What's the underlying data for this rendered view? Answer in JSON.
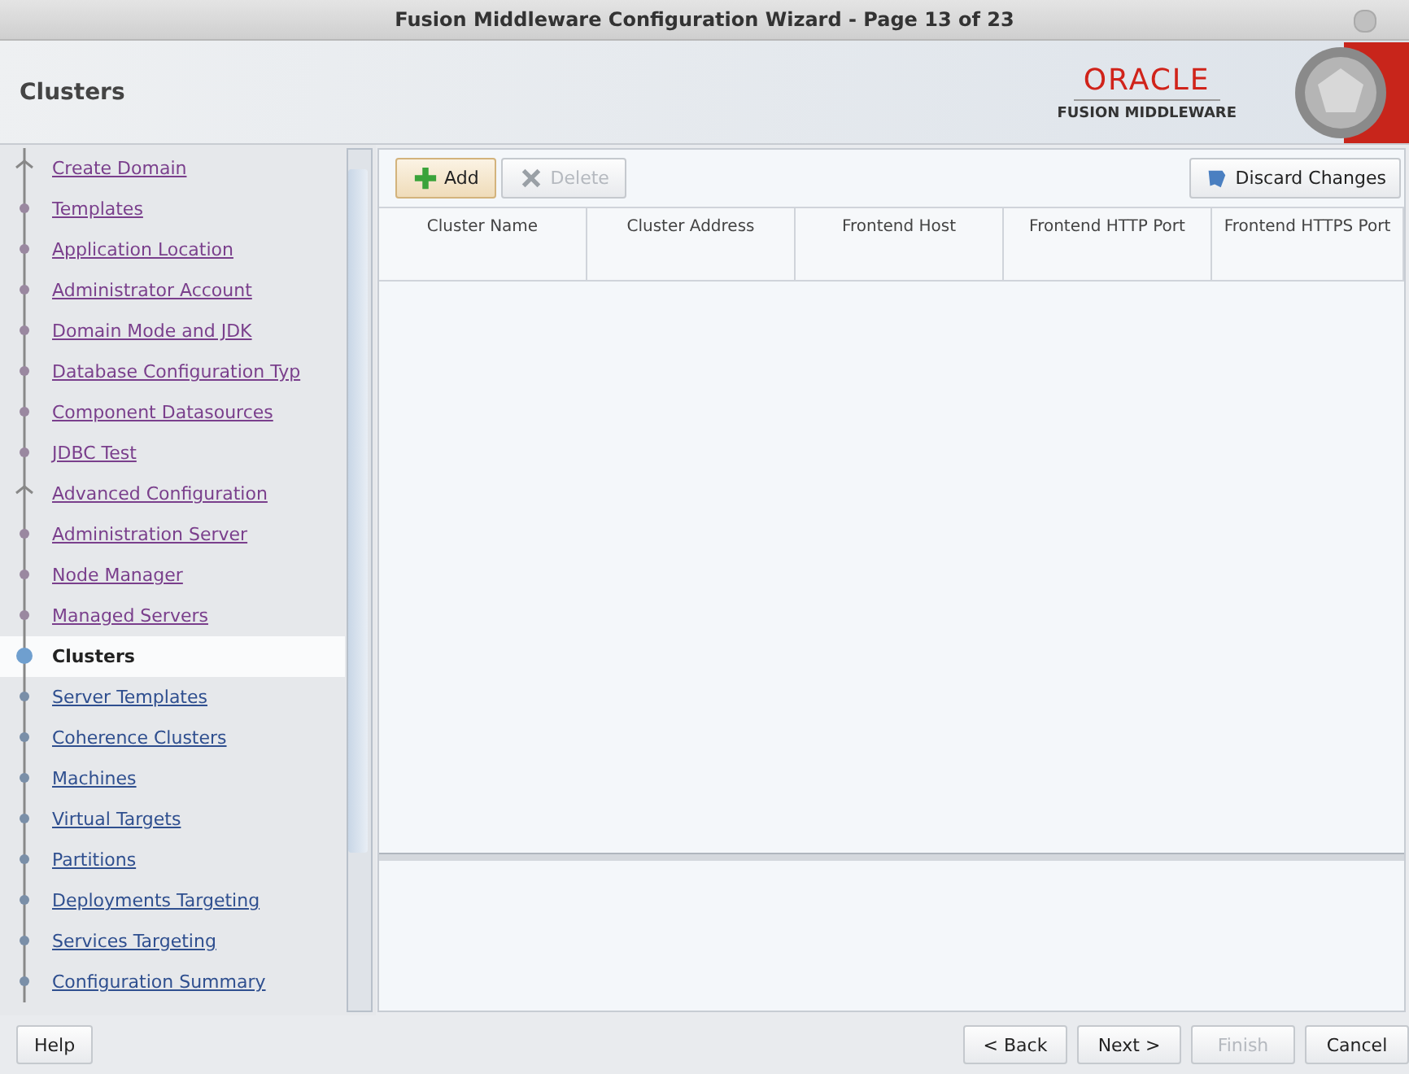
{
  "window": {
    "title": "Fusion Middleware Configuration Wizard - Page 13 of 23"
  },
  "header": {
    "title": "Clusters",
    "logo_top": "ORACLE",
    "logo_bottom": "FUSION MIDDLEWARE"
  },
  "steps": [
    {
      "label": "Create Domain",
      "visited": true,
      "selected": false,
      "kind": "group"
    },
    {
      "label": "Templates",
      "visited": true,
      "selected": false,
      "kind": "step"
    },
    {
      "label": "Application Location",
      "visited": true,
      "selected": false,
      "kind": "step"
    },
    {
      "label": "Administrator Account",
      "visited": true,
      "selected": false,
      "kind": "step"
    },
    {
      "label": "Domain Mode and JDK",
      "visited": true,
      "selected": false,
      "kind": "step"
    },
    {
      "label": "Database Configuration Typ",
      "visited": true,
      "selected": false,
      "kind": "step"
    },
    {
      "label": "Component Datasources",
      "visited": true,
      "selected": false,
      "kind": "step"
    },
    {
      "label": "JDBC Test",
      "visited": true,
      "selected": false,
      "kind": "step"
    },
    {
      "label": "Advanced Configuration",
      "visited": true,
      "selected": false,
      "kind": "group"
    },
    {
      "label": "Administration Server",
      "visited": true,
      "selected": false,
      "kind": "step"
    },
    {
      "label": "Node Manager",
      "visited": true,
      "selected": false,
      "kind": "step"
    },
    {
      "label": "Managed Servers",
      "visited": true,
      "selected": false,
      "kind": "step"
    },
    {
      "label": "Clusters",
      "visited": false,
      "selected": true,
      "kind": "step"
    },
    {
      "label": "Server Templates",
      "visited": false,
      "selected": false,
      "kind": "step"
    },
    {
      "label": "Coherence Clusters",
      "visited": false,
      "selected": false,
      "kind": "step"
    },
    {
      "label": "Machines",
      "visited": false,
      "selected": false,
      "kind": "step"
    },
    {
      "label": "Virtual Targets",
      "visited": false,
      "selected": false,
      "kind": "step"
    },
    {
      "label": "Partitions",
      "visited": false,
      "selected": false,
      "kind": "step"
    },
    {
      "label": "Deployments Targeting",
      "visited": false,
      "selected": false,
      "kind": "step"
    },
    {
      "label": "Services Targeting",
      "visited": false,
      "selected": false,
      "kind": "step"
    },
    {
      "label": "Configuration Summary",
      "visited": false,
      "selected": false,
      "kind": "step"
    }
  ],
  "toolbar": [
    {
      "label": "Add",
      "kind": "add",
      "disabled": false
    },
    {
      "label": "Delete",
      "kind": "delete",
      "disabled": true
    }
  ],
  "discard_button": {
    "label": "Discard Changes"
  },
  "table": {
    "columns": [
      "Cluster Name",
      "Cluster Address",
      "Frontend Host",
      "Frontend HTTP Port",
      "Frontend HTTPS Port"
    ]
  },
  "footer": {
    "help": "Help",
    "buttons": [
      {
        "label": "< Back",
        "disabled": false
      },
      {
        "label": "Next >",
        "disabled": false
      },
      {
        "label": "Finish",
        "disabled": true
      },
      {
        "label": "Cancel",
        "disabled": false
      }
    ]
  }
}
